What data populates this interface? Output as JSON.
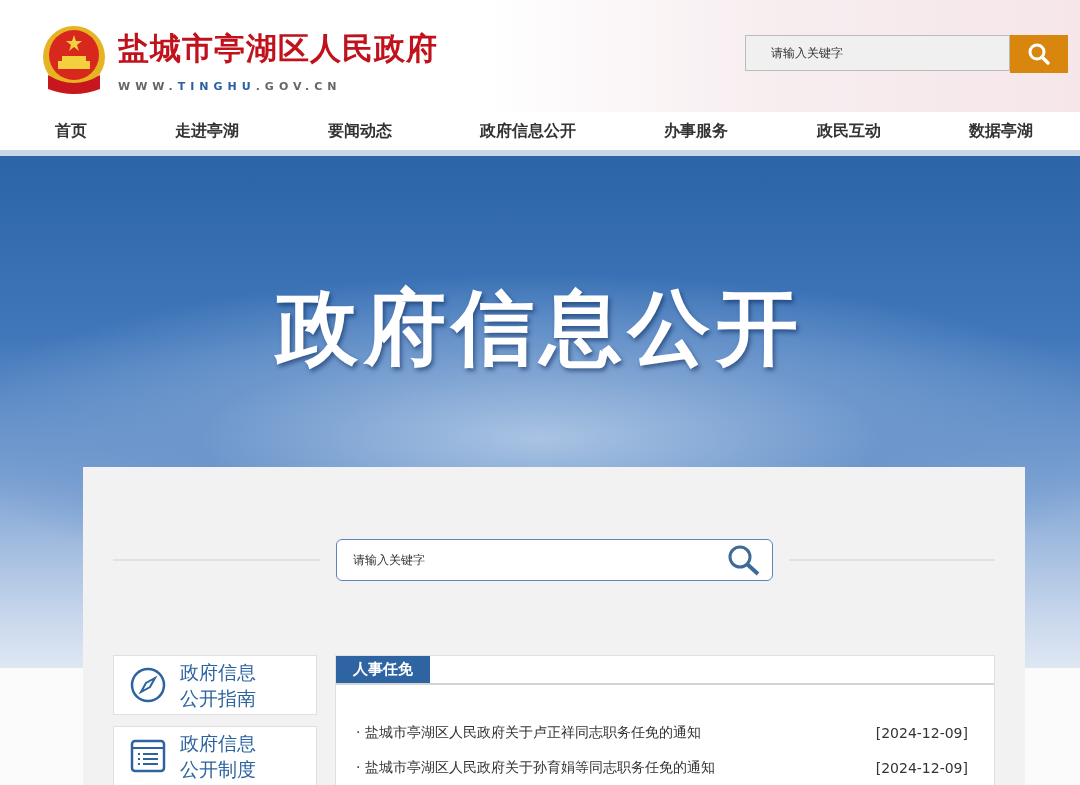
{
  "header": {
    "site_title": "盐城市亭湖区人民政府",
    "url": {
      "prefix": "WWW.",
      "domain": "TINGHU",
      "suffix": ".GOV.CN"
    },
    "search": {
      "placeholder": "请输入关键字"
    }
  },
  "nav": [
    {
      "label": "首页"
    },
    {
      "label": "走进亭湖"
    },
    {
      "label": "要闻动态"
    },
    {
      "label": "政府信息公开"
    },
    {
      "label": "办事服务"
    },
    {
      "label": "政民互动"
    },
    {
      "label": "数据亭湖"
    }
  ],
  "banner": {
    "title": "政府信息公开"
  },
  "panel_search": {
    "placeholder": "请输入关键字"
  },
  "side_links": [
    {
      "kind": "compass",
      "line1": "政府信息",
      "line2": "公开指南"
    },
    {
      "kind": "list",
      "line1": "政府信息",
      "line2": "公开制度"
    }
  ],
  "news": {
    "tabs": [
      {
        "label": "人事任免",
        "selected": true
      }
    ],
    "items": [
      {
        "title": "· 盐城市亭湖区人民政府关于卢正祥同志职务任免的通知",
        "date": "[2024-12-09]"
      },
      {
        "title": "· 盐城市亭湖区人民政府关于孙育娟等同志职务任免的通知",
        "date": "[2024-12-09]"
      }
    ]
  }
}
